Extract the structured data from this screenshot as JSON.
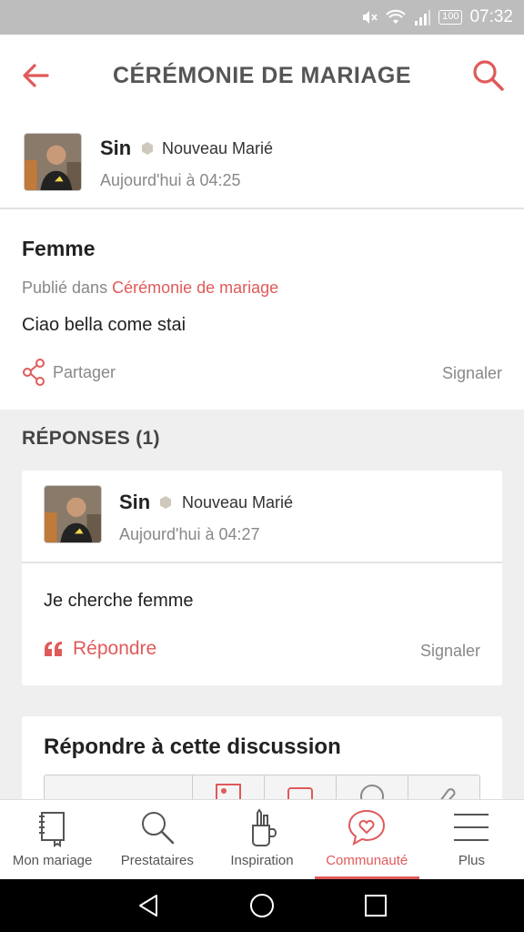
{
  "status_bar": {
    "time": "07:32",
    "battery": "100"
  },
  "app_bar": {
    "title": "CÉRÉMONIE DE MARIAGE"
  },
  "post": {
    "author": {
      "name": "Sin",
      "role": "Nouveau Marié",
      "time": "Aujourd'hui à 04:25"
    },
    "title": "Femme",
    "published_prefix": "Publié dans",
    "category": "Cérémonie de mariage",
    "text": "Ciao bella come stai",
    "share_label": "Partager",
    "report_label": "Signaler"
  },
  "responses": {
    "title": "RÉPONSES (1)",
    "items": [
      {
        "author": {
          "name": "Sin",
          "role": "Nouveau Marié",
          "time": "Aujourd'hui à 04:27"
        },
        "text": "Je cherche femme",
        "reply_label": "Répondre",
        "report_label": "Signaler"
      }
    ]
  },
  "reply_form": {
    "title": "Répondre à cette discussion"
  },
  "bottom_nav": {
    "items": [
      {
        "label": "Mon mariage",
        "icon": "notebook-icon"
      },
      {
        "label": "Prestataires",
        "icon": "search-icon"
      },
      {
        "label": "Inspiration",
        "icon": "pencil-cup-icon"
      },
      {
        "label": "Communauté",
        "icon": "chat-heart-icon",
        "active": true
      },
      {
        "label": "Plus",
        "icon": "menu-icon"
      }
    ]
  },
  "colors": {
    "accent": "#e05a5a",
    "status_bar": "#bdbdbd"
  }
}
